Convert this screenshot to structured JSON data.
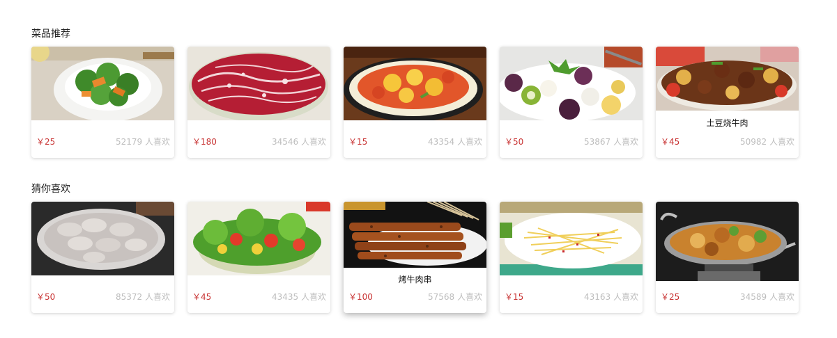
{
  "sections": [
    {
      "title": "菜品推荐",
      "items": [
        {
          "price": "￥25",
          "likes": "52179 人喜欢",
          "name": "",
          "image": "broccoli-carrot-dish"
        },
        {
          "price": "￥180",
          "likes": "34546 人喜欢",
          "name": "",
          "image": "marbled-beef-slices"
        },
        {
          "price": "￥15",
          "likes": "43354 人喜欢",
          "name": "",
          "image": "tomato-egg-stir-fry"
        },
        {
          "price": "￥50",
          "likes": "53867 人喜欢",
          "name": "",
          "image": "fruit-salad"
        },
        {
          "price": "￥45",
          "likes": "50982 人喜欢",
          "name": "土豆烧牛肉",
          "image": "potato-beef-stew"
        }
      ]
    },
    {
      "title": "猜你喜欢",
      "items": [
        {
          "price": "￥50",
          "likes": "85372 人喜欢",
          "name": "",
          "image": "dumplings"
        },
        {
          "price": "￥45",
          "likes": "43435 人喜欢",
          "name": "",
          "image": "vegetable-salad"
        },
        {
          "price": "￥100",
          "likes": "57568 人喜欢",
          "name": "烤牛肉串",
          "image": "beef-skewers"
        },
        {
          "price": "￥15",
          "likes": "43163 人喜欢",
          "name": "",
          "image": "shredded-potato"
        },
        {
          "price": "￥25",
          "likes": "34589 人喜欢",
          "name": "",
          "image": "dry-pot-dish"
        }
      ]
    }
  ],
  "colors": {
    "price": "#c83232",
    "likes": "#bdbdbd",
    "title": "#222222"
  }
}
